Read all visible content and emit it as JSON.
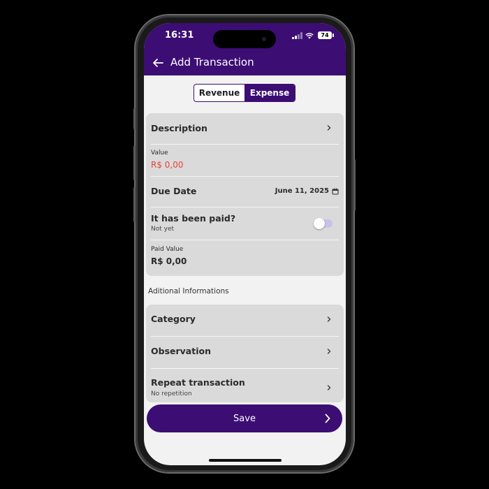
{
  "status_bar": {
    "time": "16:31",
    "battery": "74"
  },
  "app_bar": {
    "title": "Add Transaction",
    "back_icon": "arrow-left-icon"
  },
  "segment": {
    "options": [
      "Revenue",
      "Expense"
    ],
    "selected": "Expense"
  },
  "form": {
    "description": {
      "label": "Description"
    },
    "value": {
      "label": "Value",
      "amount": "R$ 0,00"
    },
    "due_date": {
      "label": "Due Date",
      "date": "June 11, 2025"
    },
    "paid": {
      "label": "It has been paid?",
      "status": "Not yet",
      "toggle_on": false
    },
    "paid_value": {
      "label": "Paid Value",
      "amount": "R$ 0,00"
    }
  },
  "additional": {
    "section_label": "Aditional Informations",
    "category": {
      "label": "Category"
    },
    "observation": {
      "label": "Observation"
    },
    "repeat": {
      "label": "Repeat transaction",
      "status": "No repetition"
    }
  },
  "save_button": {
    "label": "Save"
  },
  "colors": {
    "primary": "#3c0d73",
    "value_red": "#e8413a",
    "card_bg": "#dadada",
    "screen_bg": "#f2f2f2",
    "toggle_track": "#c9c2e8"
  }
}
